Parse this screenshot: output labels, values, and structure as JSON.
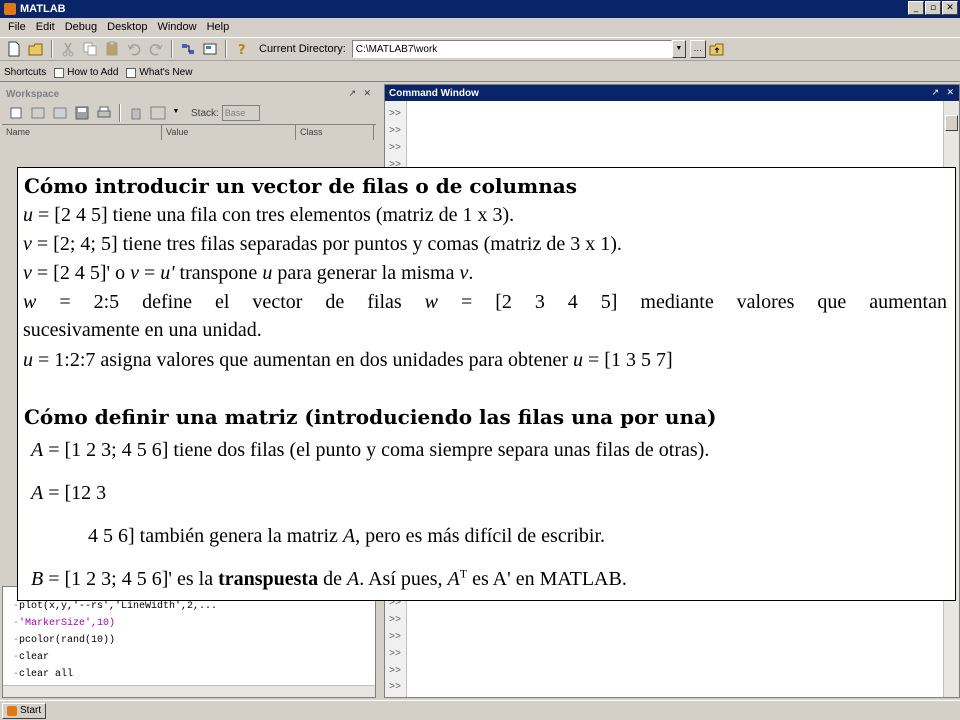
{
  "window": {
    "title": "MATLAB"
  },
  "menu": [
    "File",
    "Edit",
    "Debug",
    "Desktop",
    "Window",
    "Help"
  ],
  "toolbar": {
    "current_directory_label": "Current Directory:",
    "current_directory_value": "C:\\MATLAB7\\work"
  },
  "shortcuts": {
    "label": "Shortcuts",
    "items": [
      "How to Add",
      "What's New"
    ]
  },
  "workspace": {
    "title": "Workspace",
    "stack_label": "Stack:",
    "stack_value": "Base",
    "columns": [
      "Name",
      "Value",
      "Class"
    ]
  },
  "command_window": {
    "title": "Command Window",
    "prompt": ">>"
  },
  "history": {
    "lines": [
      {
        "prefix": "-",
        "text": "plot(x,y,'--rs','LineWidth',2,..."
      },
      {
        "prefix": "-",
        "text": "'MarkerSize',10)"
      },
      {
        "prefix": "-",
        "text": "pcolor(rand(10))"
      },
      {
        "prefix": "-",
        "text": "clear"
      },
      {
        "prefix": "-",
        "text": "clear all"
      }
    ]
  },
  "taskbar": {
    "start_label": "Start"
  },
  "overlay": {
    "heading1": "Cómo introducir un vector de filas o de columnas",
    "line1": {
      "var": "u",
      "text": " = [2 4 5] tiene una fila con tres elementos (matriz de 1 x 3)."
    },
    "line2": {
      "var": "v",
      "text": " = [2; 4; 5] tiene tres filas separadas por puntos y comas (matriz de 3 x 1)."
    },
    "line3": {
      "v1": "v",
      "t1": " = [2 4 5]' o ",
      "v2": "v",
      "t2": " = ",
      "v3": "u'",
      "t3": " transpone ",
      "v4": "u",
      "t4": " para generar la misma ",
      "v5": "v",
      "t5": "."
    },
    "line4": {
      "var": "w",
      "t1": " = 2:5 define el vector de filas ",
      "var2": "w",
      "t2": " = [2 3 4 5] mediante valores que aumentan"
    },
    "line5": "sucesivamente en una unidad.",
    "line6": {
      "var": "u",
      "t1": " = 1:2:7 asigna valores que aumentan en dos unidades para obtener ",
      "var2": "u",
      "t2": " = [1 3 5 7]"
    },
    "heading2": "Cómo definir una matriz (introduciendo las filas una por una)",
    "line7": {
      "var": "A",
      "text": " = [1 2 3; 4 5 6] tiene dos filas (el punto y coma siempre separa unas filas de otras)."
    },
    "line8": {
      "var": "A",
      "text": " = [12 3"
    },
    "line9": {
      "t1": "4 5 6]  también genera la matriz ",
      "var": "A",
      "t2": ", pero es más difícil de escribir."
    },
    "line10": {
      "var": "B",
      "t1": " = [1 2 3; 4 5 6]' es la ",
      "bold": "transpuesta",
      "t2": " de ",
      "var2": "A",
      "t3": ". Así pues, ",
      "var3": "A",
      "sup": "T",
      "t4": " es A' en MATLAB."
    }
  }
}
